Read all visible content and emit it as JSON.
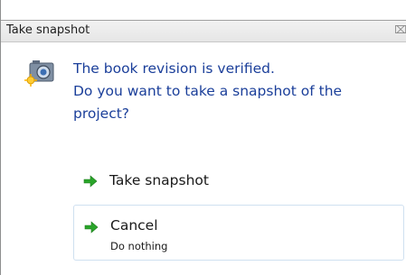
{
  "dialog": {
    "title": "Take snapshot",
    "close_icon": "close-icon",
    "message_icon": "camera-icon",
    "message": "The book revision is verified.\nDo you want to take a snapshot of the project?"
  },
  "options": {
    "snapshot": {
      "icon": "green-arrow-icon",
      "label": "Take snapshot"
    },
    "cancel": {
      "icon": "green-arrow-icon",
      "label": "Cancel",
      "description": "Do nothing"
    }
  },
  "colors": {
    "message_text": "#1b3f9a",
    "arrow": "#2aa52a",
    "option_border": "#cfe0f0"
  }
}
